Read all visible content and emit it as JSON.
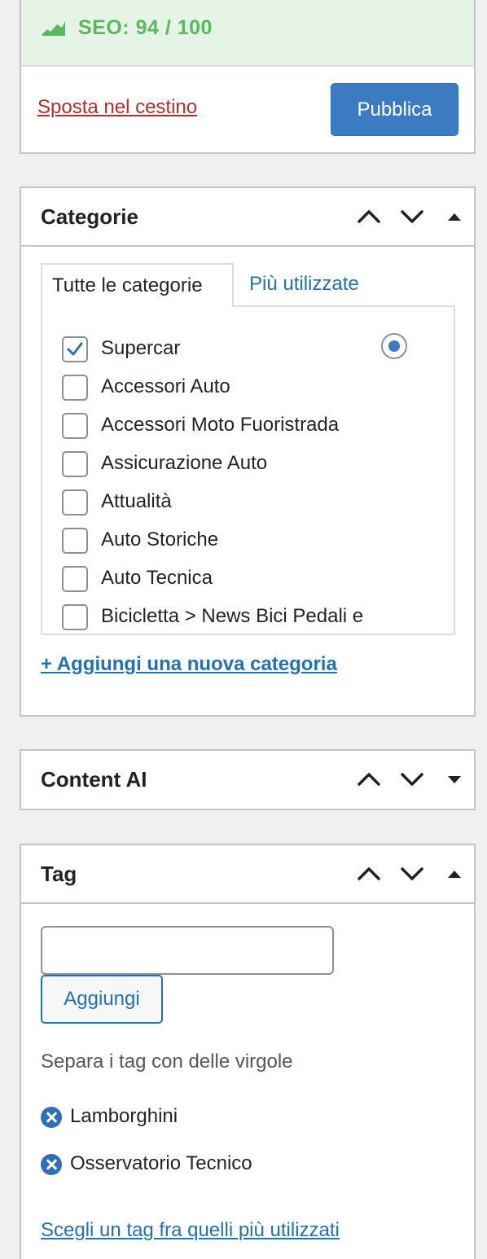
{
  "publish": {
    "seo_label": "SEO: 94 / 100",
    "trash_label": "Sposta nel cestino",
    "publish_label": "Pubblica",
    "seo_color": "#5bb85c"
  },
  "categories": {
    "title": "Categorie",
    "tabs": [
      "Tutte le categorie",
      "Più utilizzate"
    ],
    "items": [
      {
        "label": "Supercar",
        "checked": true
      },
      {
        "label": "Accessori Auto",
        "checked": false
      },
      {
        "label": "Accessori Moto Fuoristrada",
        "checked": false
      },
      {
        "label": "Assicurazione Auto",
        "checked": false
      },
      {
        "label": "Attualità",
        "checked": false
      },
      {
        "label": "Auto Storiche",
        "checked": false
      },
      {
        "label": "Auto Tecnica",
        "checked": false
      },
      {
        "label": "Bicicletta > News Bici Pedali e",
        "checked": false
      }
    ],
    "add_link": "+ Aggiungi una nuova categoria"
  },
  "content_ai": {
    "title": "Content AI"
  },
  "tags": {
    "title": "Tag",
    "input_value": "",
    "add_label": "Aggiungi",
    "hint": "Separa i tag con delle virgole",
    "items": [
      "Lamborghini",
      "Osservatorio Tecnico"
    ],
    "popular_link": "Scegli un tag fra quelli più utilizzati"
  },
  "icons": {
    "move_up": "chevron-up-icon",
    "move_down": "chevron-down-icon",
    "toggle_open": "triangle-up-icon",
    "toggle_closed": "triangle-down-icon",
    "remove_tag": "remove-circle-icon",
    "seo": "rank-math-icon"
  },
  "accent_color": "#2271b1"
}
